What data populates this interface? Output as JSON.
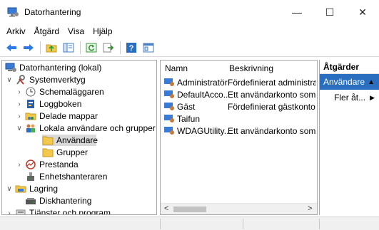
{
  "window": {
    "title": "Datorhantering",
    "minimize_glyph": "—",
    "maximize_glyph": "☐",
    "close_glyph": "✕"
  },
  "menu": [
    "Arkiv",
    "Åtgärd",
    "Visa",
    "Hjälp"
  ],
  "toolbar": {
    "icons": [
      "back-arrow-icon",
      "forward-arrow-icon",
      "up-folder-icon",
      "show-hide-tree-icon",
      "refresh-icon",
      "export-list-icon",
      "help-icon",
      "properties-icon"
    ]
  },
  "tree": {
    "root": "Datorhantering (lokal)",
    "items": [
      {
        "label": "Systemverktyg",
        "icon": "tools-icon"
      },
      {
        "label": "Schemaläggaren",
        "icon": "clock-icon"
      },
      {
        "label": "Loggboken",
        "icon": "event-log-icon"
      },
      {
        "label": "Delade mappar",
        "icon": "shared-folder-icon"
      },
      {
        "label": "Lokala användare och grupper",
        "icon": "users-groups-icon"
      },
      {
        "label": "Användare",
        "icon": "folder-icon"
      },
      {
        "label": "Grupper",
        "icon": "folder-icon"
      },
      {
        "label": "Prestanda",
        "icon": "performance-icon"
      },
      {
        "label": "Enhetshanteraren",
        "icon": "device-manager-icon"
      },
      {
        "label": "Lagring",
        "icon": "storage-icon"
      },
      {
        "label": "Diskhantering",
        "icon": "disk-icon"
      },
      {
        "label": "Tjänster och program",
        "icon": "services-icon"
      }
    ]
  },
  "list": {
    "columns": [
      "Namn",
      "Beskrivning"
    ],
    "rows": [
      {
        "name": "Administratör",
        "description": "Fördefinierat administratö"
      },
      {
        "name": "DefaultAcco...",
        "description": "Ett användarkonto som ha"
      },
      {
        "name": "Gäst",
        "description": "Fördefinierat gästkonto fö"
      },
      {
        "name": "Taifun",
        "description": ""
      },
      {
        "name": "WDAGUtility...",
        "description": "Ett användarkonto som ha"
      }
    ],
    "scroll_left": "<",
    "scroll_right": ">"
  },
  "actions": {
    "header": "Åtgärder",
    "section": "Användare",
    "section_arrow": "▲",
    "more": "Fler åt...",
    "more_arrow": "▶"
  },
  "colors": {
    "selection_blue": "#2a6fbf",
    "tree_selected": "#d9d9d9",
    "folder_yellow": "#f2c94c"
  }
}
